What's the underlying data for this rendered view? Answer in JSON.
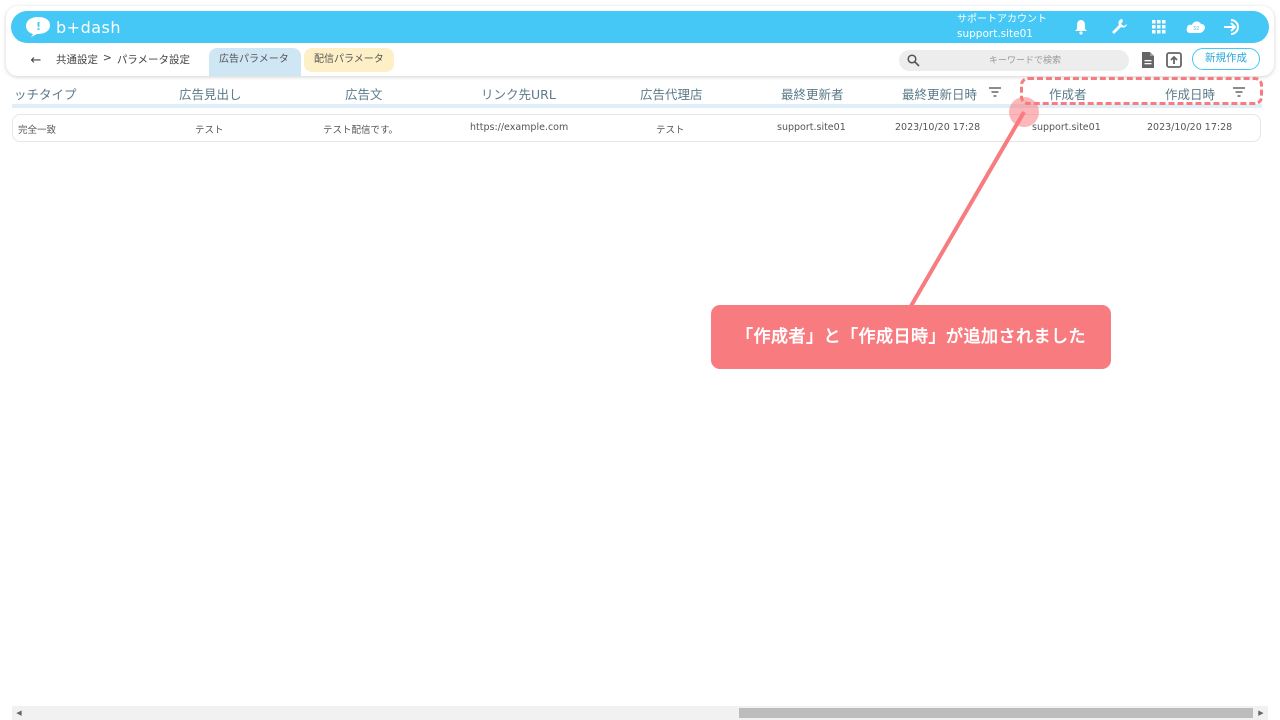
{
  "app": {
    "logo_text": "b+dash"
  },
  "account": {
    "label": "サポートアカウント",
    "name": "support.site01"
  },
  "topbar_icons": [
    "bell-icon",
    "wrench-icon",
    "grid-icon",
    "cloud-icon",
    "logout-icon"
  ],
  "breadcrumb": {
    "section": "共通設定",
    "separator": ">",
    "page": "パラメータ設定"
  },
  "tabs": [
    {
      "label": "広告パラメータ",
      "active": true
    },
    {
      "label": "配信パラメータ",
      "active": false
    }
  ],
  "search": {
    "placeholder": "キーワードで検索"
  },
  "toolbar": {
    "new_label": "新規作成"
  },
  "table": {
    "columns": [
      "ッチタイプ",
      "広告見出し",
      "広告文",
      "リンク先URL",
      "広告代理店",
      "最終更新者",
      "最終更新日時",
      "作成者",
      "作成日時"
    ],
    "rows": [
      [
        "完全一致",
        "テスト",
        "テスト配信です。",
        "https://example.com",
        "テスト",
        "support.site01",
        "2023/10/20 17:28",
        "support.site01",
        "2023/10/20 17:28"
      ]
    ]
  },
  "annotation": {
    "text": "「作成者」と「作成日時」が追加されました",
    "color": "#f77b7f"
  },
  "colors": {
    "brand": "#45c8f5",
    "tab_active": "#cfe6f5",
    "tab_inactive": "#fdefc6"
  }
}
